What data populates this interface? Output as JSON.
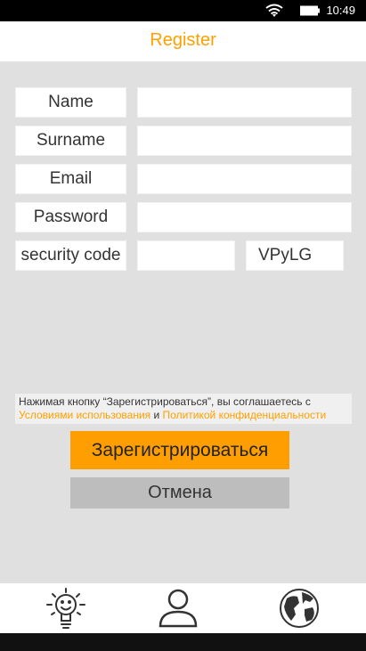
{
  "status_bar": {
    "time": "10:49",
    "icons": [
      "wifi-icon",
      "battery-icon"
    ]
  },
  "app_bar": {
    "title": "Register"
  },
  "form": {
    "fields": [
      {
        "label": "Name",
        "value": ""
      },
      {
        "label": "Surname",
        "value": ""
      },
      {
        "label": "Email",
        "value": ""
      },
      {
        "label": "Password",
        "value": ""
      }
    ],
    "security_code": {
      "label": "security code",
      "value": "",
      "code": "VPyLG"
    }
  },
  "terms": {
    "prefix": "Нажимая кнопку “Зарегистрироваться”, вы соглашаетесь с",
    "terms_link": "Условиями использования",
    "conjunction": "и",
    "privacy_link": "Политикой конфиденциальности"
  },
  "buttons": {
    "register": "Зарегистрироваться",
    "cancel": "Отмена"
  },
  "bottom_nav": {
    "items": [
      "ideas-icon",
      "profile-icon",
      "globe-icon"
    ]
  },
  "colors": {
    "accent": "#ffa000",
    "register_button": "#ff9e00",
    "cancel_button": "#bdbdbd",
    "background": "#e0e0e0"
  }
}
